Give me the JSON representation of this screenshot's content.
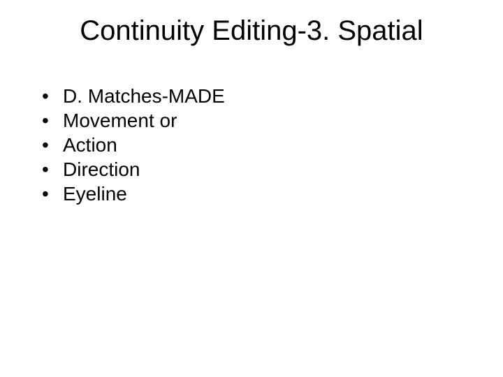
{
  "slide": {
    "title": "Continuity Editing-3. Spatial",
    "bullets": [
      "D. Matches-MADE",
      "Movement or",
      "Action",
      "Direction",
      "Eyeline"
    ],
    "bullet_char": "•"
  }
}
